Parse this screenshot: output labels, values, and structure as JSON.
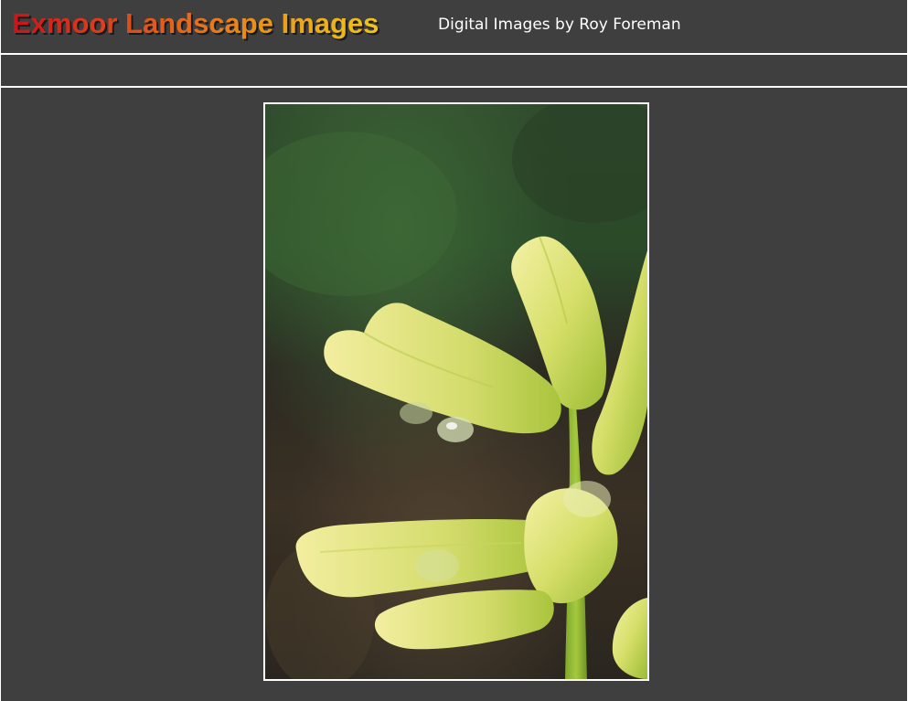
{
  "header": {
    "title": "Exmoor Landscape Images",
    "subtitle": "Digital Images by Roy Foreman"
  },
  "colors": {
    "background": "#3f3f3f",
    "rule": "#ffffff",
    "title_gradient_start": "#c8141a",
    "title_gradient_end": "#f0c41a",
    "subtitle_text": "#ffffff"
  },
  "photo": {
    "subject": "flower-buds-photo"
  }
}
